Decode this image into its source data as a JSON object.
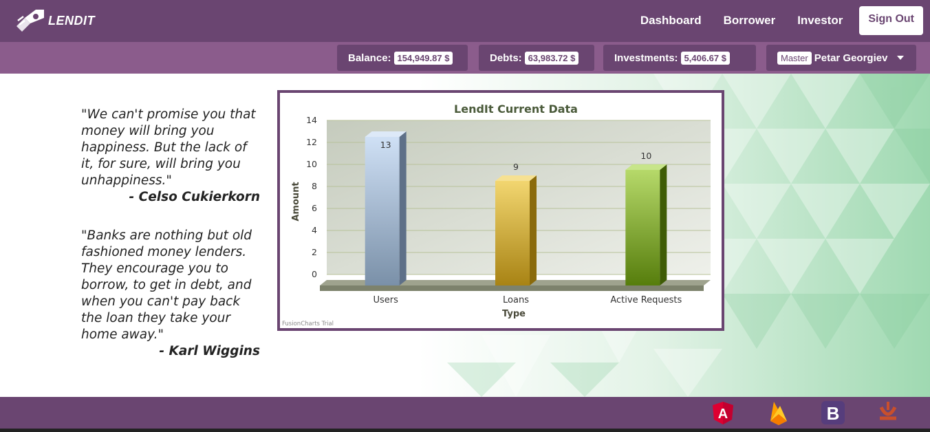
{
  "brand": {
    "name": "LENDIT"
  },
  "nav": {
    "links": [
      "Dashboard",
      "Borrower",
      "Investor"
    ],
    "signout": "Sign Out"
  },
  "summary": {
    "balance_label": "Balance:",
    "balance_value": "154,949.87 $",
    "debts_label": "Debts:",
    "debts_value": "63,983.72 $",
    "investments_label": "Investments:",
    "investments_value": "5,406.67 $",
    "user_role": "Master",
    "user_name": "Petar Georgiev"
  },
  "quotes": [
    {
      "text": "\"We can't promise you that money will bring you happiness. But the lack of it, for sure, will bring you unhappiness.\"",
      "author": "- Celso Cukierkorn"
    },
    {
      "text": "\"Banks are nothing but old fashioned money lenders. They encourage you to borrow, to get in debt, and when you can't pay back the loan they take your home away.\"",
      "author": "- Karl Wiggins"
    }
  ],
  "chart_data": {
    "type": "bar",
    "title": "LendIt Current Data",
    "xlabel": "Type",
    "ylabel": "Amount",
    "categories": [
      "Users",
      "Loans",
      "Active Requests"
    ],
    "values": [
      13,
      9,
      10
    ],
    "ylim": [
      0,
      14
    ],
    "yticks": [
      0,
      2,
      4,
      6,
      8,
      10,
      12,
      14
    ],
    "colors": [
      "#9fb3cc",
      "#d4a92c",
      "#7ea22a"
    ],
    "grid": true,
    "watermark": "FusionCharts Trial"
  },
  "footer": {
    "icons": [
      "angular-icon",
      "firebase-icon",
      "bootstrap-icon",
      "jasmine-icon"
    ]
  },
  "colors": {
    "primary": "#6a4571",
    "secondary": "#8b5c8c",
    "accent_green": "#a8dcb8"
  }
}
